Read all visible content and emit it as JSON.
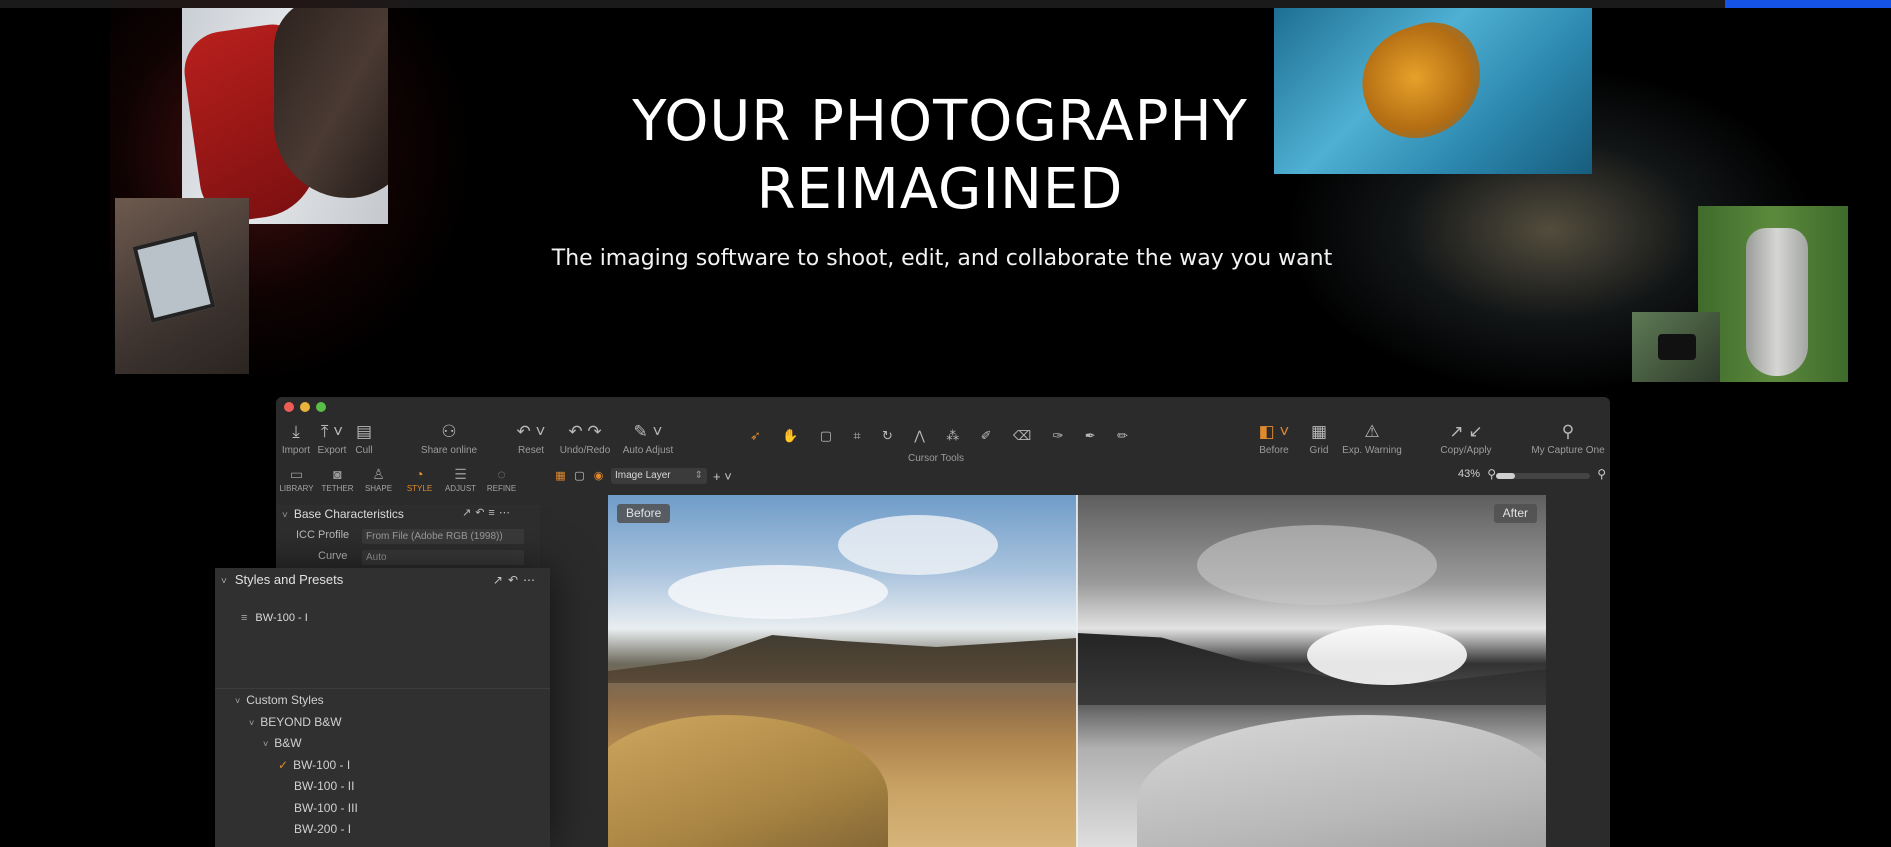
{
  "hero": {
    "title_line1": "YOUR PHOTOGRAPHY",
    "title_line2": "REIMAGINED",
    "subtitle": "The imaging software to shoot, edit, and collaborate the way you want"
  },
  "colors": {
    "accent_blue": "#1552e6",
    "accent_orange": "#e08a2e",
    "app_bg": "#2b2b2b"
  },
  "toolbar": {
    "left_tools": [
      {
        "label": "Import",
        "icon": "import-icon"
      },
      {
        "label": "Export",
        "icon": "export-icon"
      },
      {
        "label": "Cull",
        "icon": "cull-icon"
      },
      {
        "label": "Share online",
        "icon": "share-icon"
      },
      {
        "label": "Reset",
        "icon": "reset-icon"
      },
      {
        "label": "Undo/Redo",
        "icon": "undo-redo-icon"
      },
      {
        "label": "Auto Adjust",
        "icon": "auto-adjust-icon"
      }
    ],
    "cursor_tools_label": "Cursor Tools",
    "right_tools": [
      {
        "label": "Before",
        "icon": "before-icon"
      },
      {
        "label": "Grid",
        "icon": "grid-icon"
      },
      {
        "label": "Exp. Warning",
        "icon": "warning-icon"
      },
      {
        "label": "Copy/Apply",
        "icon": "copy-apply-icon"
      },
      {
        "label": "My Capture One",
        "icon": "user-icon"
      }
    ]
  },
  "tabs": [
    {
      "label": "LIBRARY",
      "icon": "folder-icon"
    },
    {
      "label": "TETHER",
      "icon": "camera-icon"
    },
    {
      "label": "SHAPE",
      "icon": "shape-icon"
    },
    {
      "label": "STYLE",
      "icon": "style-icon",
      "active": true
    },
    {
      "label": "ADJUST",
      "icon": "sliders-icon"
    },
    {
      "label": "REFINE",
      "icon": "refine-icon"
    }
  ],
  "layer": {
    "selected": "Image Layer"
  },
  "zoom": {
    "value": "43%",
    "slider_fraction": 0.2
  },
  "base_panel": {
    "title": "Base Characteristics",
    "icc_label": "ICC Profile",
    "icc_value": "From File (Adobe RGB (1998))",
    "curve_label": "Curve",
    "curve_value": "Auto"
  },
  "viewer": {
    "before_label": "Before",
    "after_label": "After"
  },
  "styles_panel": {
    "title": "Styles and Presets",
    "current_style": "BW-100 - I",
    "tree": {
      "custom_styles": "Custom Styles",
      "folder": "BEYOND B&W",
      "subfolder": "B&W",
      "items": [
        "BW-100 - I",
        "BW-100 - II",
        "BW-100 - III",
        "BW-200 - I"
      ],
      "checked_index": 0
    }
  }
}
